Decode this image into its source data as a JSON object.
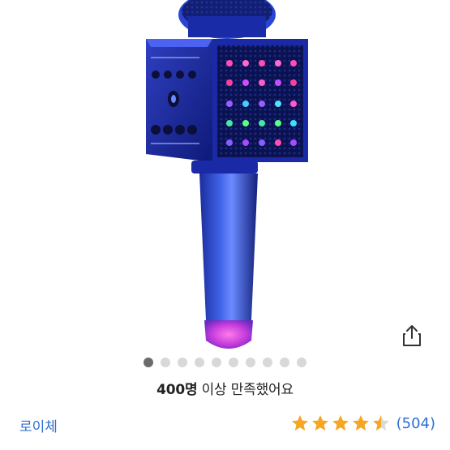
{
  "product": {
    "image_alt": "karaoke microphone with LED speaker",
    "carousel": {
      "total": 10,
      "active_index": 0
    }
  },
  "satisfaction": {
    "count": "400명",
    "text": " 이상 만족했어요"
  },
  "seller": {
    "name": "로이체"
  },
  "rating": {
    "value": 4.5,
    "max": 5,
    "review_count": "(504)"
  },
  "icons": {
    "share": "share-icon",
    "star": "star-icon"
  },
  "colors": {
    "accent": "#2f6fd1",
    "star": "#f5a623",
    "star_empty": "#d9d9d9"
  }
}
